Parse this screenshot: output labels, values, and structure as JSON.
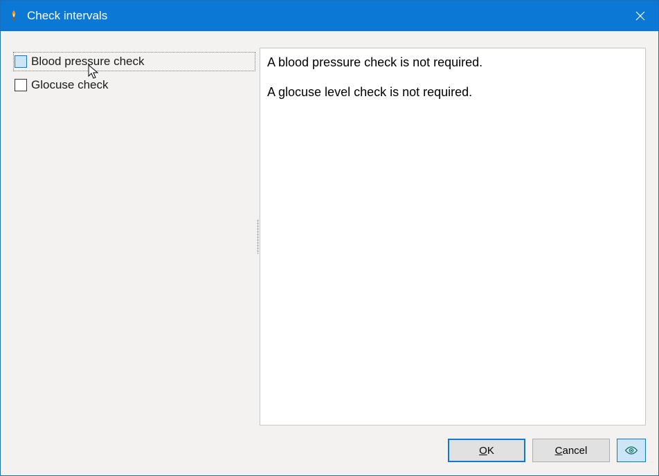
{
  "window": {
    "title": "Check intervals"
  },
  "checks": [
    {
      "label": "Blood pressure check",
      "checked": false,
      "focused": true
    },
    {
      "label": "Glocuse check",
      "checked": false,
      "focused": false
    }
  ],
  "messages": [
    "A blood pressure check is not required.",
    "A glocuse level check is not required."
  ],
  "buttons": {
    "ok": "OK",
    "cancel": "Cancel"
  },
  "icons": {
    "app": "torch-icon",
    "close": "close-icon",
    "preview": "eye-icon"
  },
  "colors": {
    "titlebar": "#0a78d4",
    "accent": "#0a78d4",
    "body": "#f3f2f1"
  }
}
